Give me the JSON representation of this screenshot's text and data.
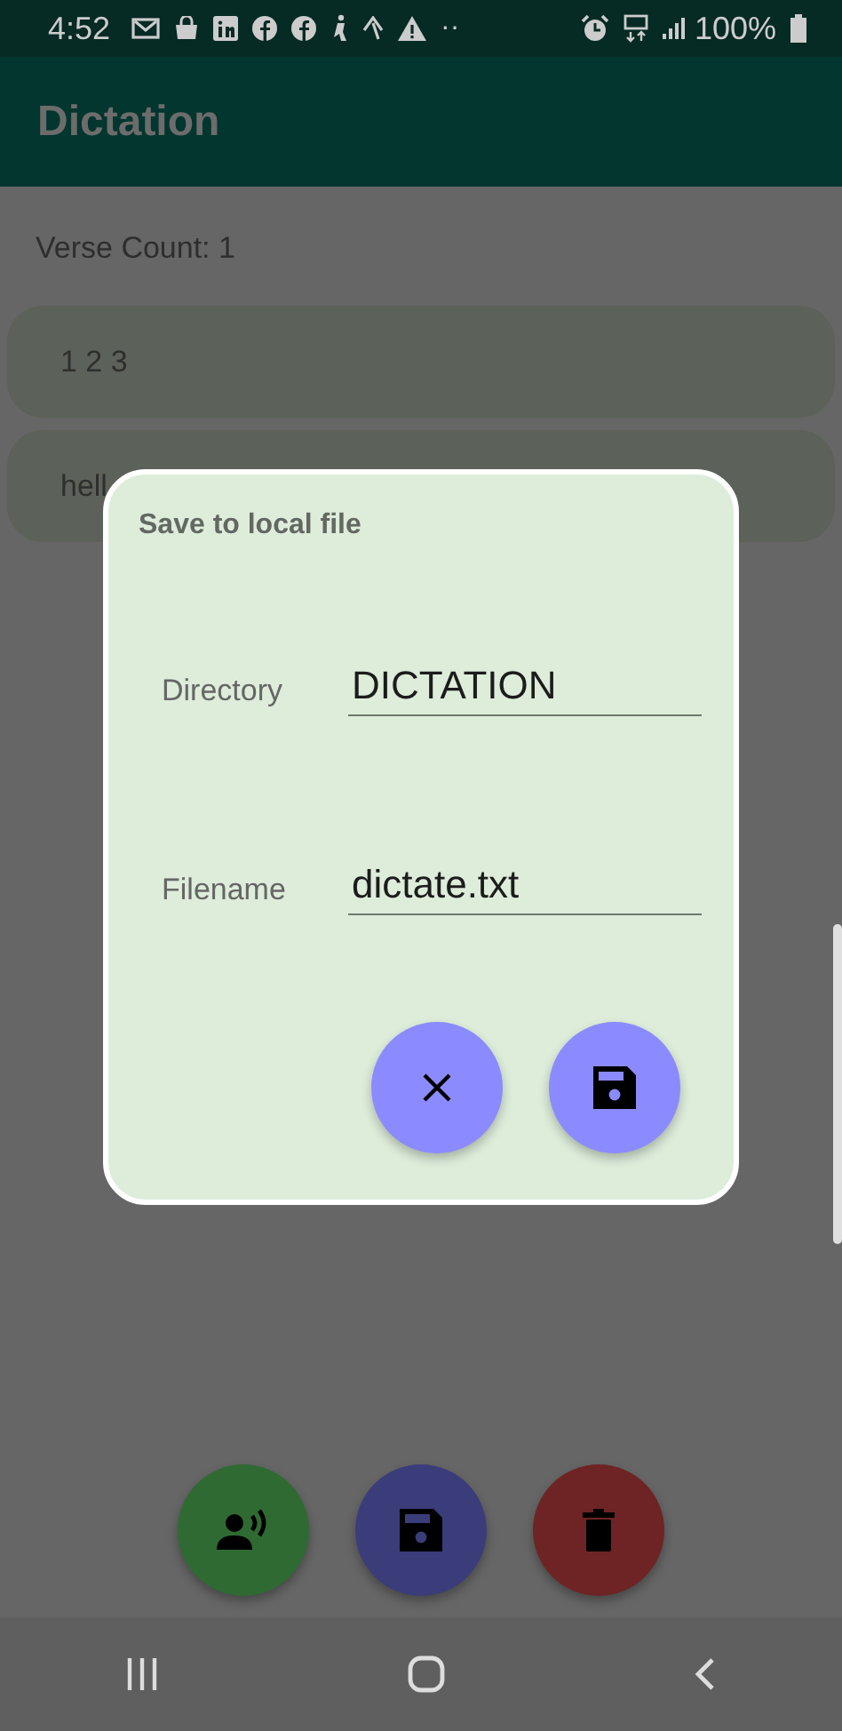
{
  "status_bar": {
    "time": "4:52",
    "dots": "··",
    "battery": "100%"
  },
  "app_bar": {
    "title": "Dictation"
  },
  "verse_count": "Verse Count: 1",
  "verses": [
    {
      "text": "1 2 3"
    },
    {
      "text": "hell"
    }
  ],
  "dialog": {
    "title": "Save to local file",
    "fields": [
      {
        "label": "Directory",
        "value": "DICTATION"
      },
      {
        "label": "Filename",
        "value": "dictate.txt"
      }
    ],
    "buttons": [
      {
        "kind": "close"
      },
      {
        "kind": "save"
      }
    ]
  },
  "fabs": [
    {
      "kind": "speak",
      "color": "#2f6a33"
    },
    {
      "kind": "save",
      "color": "#3a3d7a"
    },
    {
      "kind": "delete",
      "color": "#6e2424"
    }
  ],
  "nav": [
    {
      "kind": "recent"
    },
    {
      "kind": "home"
    },
    {
      "kind": "back"
    }
  ]
}
